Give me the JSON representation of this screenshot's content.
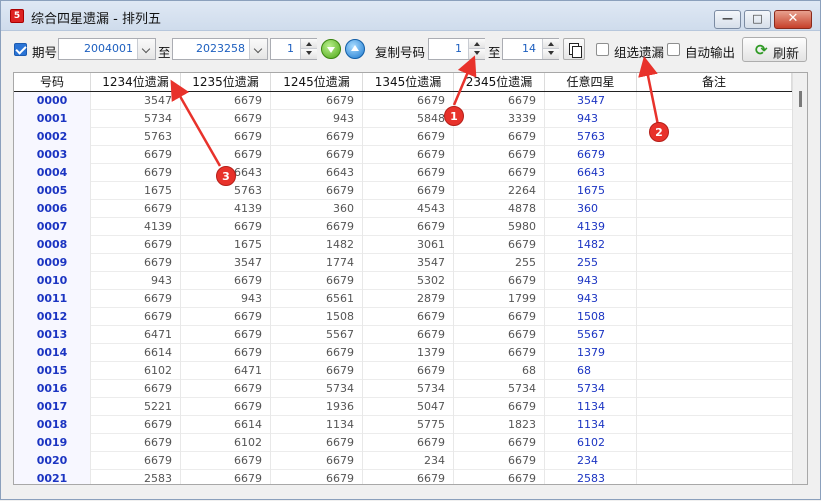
{
  "window": {
    "title": "综合四星遗漏 - 排列五",
    "app_badge": "5",
    "min_glyph": "—",
    "max_glyph": "□",
    "close_glyph": "✕"
  },
  "toolbar": {
    "period_label": "期号",
    "period_checked": true,
    "period_from": "2004001",
    "to_label": "至",
    "period_to": "2023258",
    "step_value": "1",
    "copy_label": "复制号码",
    "copy_from": "1",
    "copy_to_label": "至",
    "copy_to": "14",
    "group_miss_label": "组选遗漏",
    "group_miss_checked": false,
    "auto_output_label": "自动输出",
    "auto_output_checked": false,
    "refresh_label": "刷新",
    "refresh_icon": "refresh-icon"
  },
  "grid": {
    "columns": [
      "号码",
      "1234位遗漏",
      "1235位遗漏",
      "1245位遗漏",
      "1345位遗漏",
      "2345位遗漏",
      "任意四星",
      "备注"
    ],
    "rows": [
      [
        "0000",
        "3547",
        "6679",
        "6679",
        "6679",
        "6679",
        "3547",
        ""
      ],
      [
        "0001",
        "5734",
        "6679",
        "943",
        "5848",
        "3339",
        "943",
        ""
      ],
      [
        "0002",
        "5763",
        "6679",
        "6679",
        "6679",
        "6679",
        "5763",
        ""
      ],
      [
        "0003",
        "6679",
        "6679",
        "6679",
        "6679",
        "6679",
        "6679",
        ""
      ],
      [
        "0004",
        "6679",
        "6643",
        "6643",
        "6679",
        "6679",
        "6643",
        ""
      ],
      [
        "0005",
        "1675",
        "5763",
        "6679",
        "6679",
        "2264",
        "1675",
        ""
      ],
      [
        "0006",
        "6679",
        "4139",
        "360",
        "4543",
        "4878",
        "360",
        ""
      ],
      [
        "0007",
        "4139",
        "6679",
        "6679",
        "6679",
        "5980",
        "4139",
        ""
      ],
      [
        "0008",
        "6679",
        "1675",
        "1482",
        "3061",
        "6679",
        "1482",
        ""
      ],
      [
        "0009",
        "6679",
        "3547",
        "1774",
        "3547",
        "255",
        "255",
        ""
      ],
      [
        "0010",
        "943",
        "6679",
        "6679",
        "5302",
        "6679",
        "943",
        ""
      ],
      [
        "0011",
        "6679",
        "943",
        "6561",
        "2879",
        "1799",
        "943",
        ""
      ],
      [
        "0012",
        "6679",
        "6679",
        "1508",
        "6679",
        "6679",
        "1508",
        ""
      ],
      [
        "0013",
        "6471",
        "6679",
        "5567",
        "6679",
        "6679",
        "5567",
        ""
      ],
      [
        "0014",
        "6614",
        "6679",
        "6679",
        "1379",
        "6679",
        "1379",
        ""
      ],
      [
        "0015",
        "6102",
        "6471",
        "6679",
        "6679",
        "68",
        "68",
        ""
      ],
      [
        "0016",
        "6679",
        "6679",
        "5734",
        "5734",
        "5734",
        "5734",
        ""
      ],
      [
        "0017",
        "5221",
        "6679",
        "1936",
        "5047",
        "6679",
        "1134",
        ""
      ],
      [
        "0018",
        "6679",
        "6614",
        "1134",
        "5775",
        "1823",
        "1134",
        ""
      ],
      [
        "0019",
        "6679",
        "6102",
        "6679",
        "6679",
        "6679",
        "6102",
        ""
      ],
      [
        "0020",
        "6679",
        "6679",
        "6679",
        "234",
        "6679",
        "234",
        ""
      ],
      [
        "0021",
        "2583",
        "6679",
        "6679",
        "6679",
        "6679",
        "2583",
        ""
      ]
    ]
  },
  "annotations": {
    "marker_1": "1",
    "marker_2": "2",
    "marker_3": "3",
    "color": "#e8322b"
  }
}
